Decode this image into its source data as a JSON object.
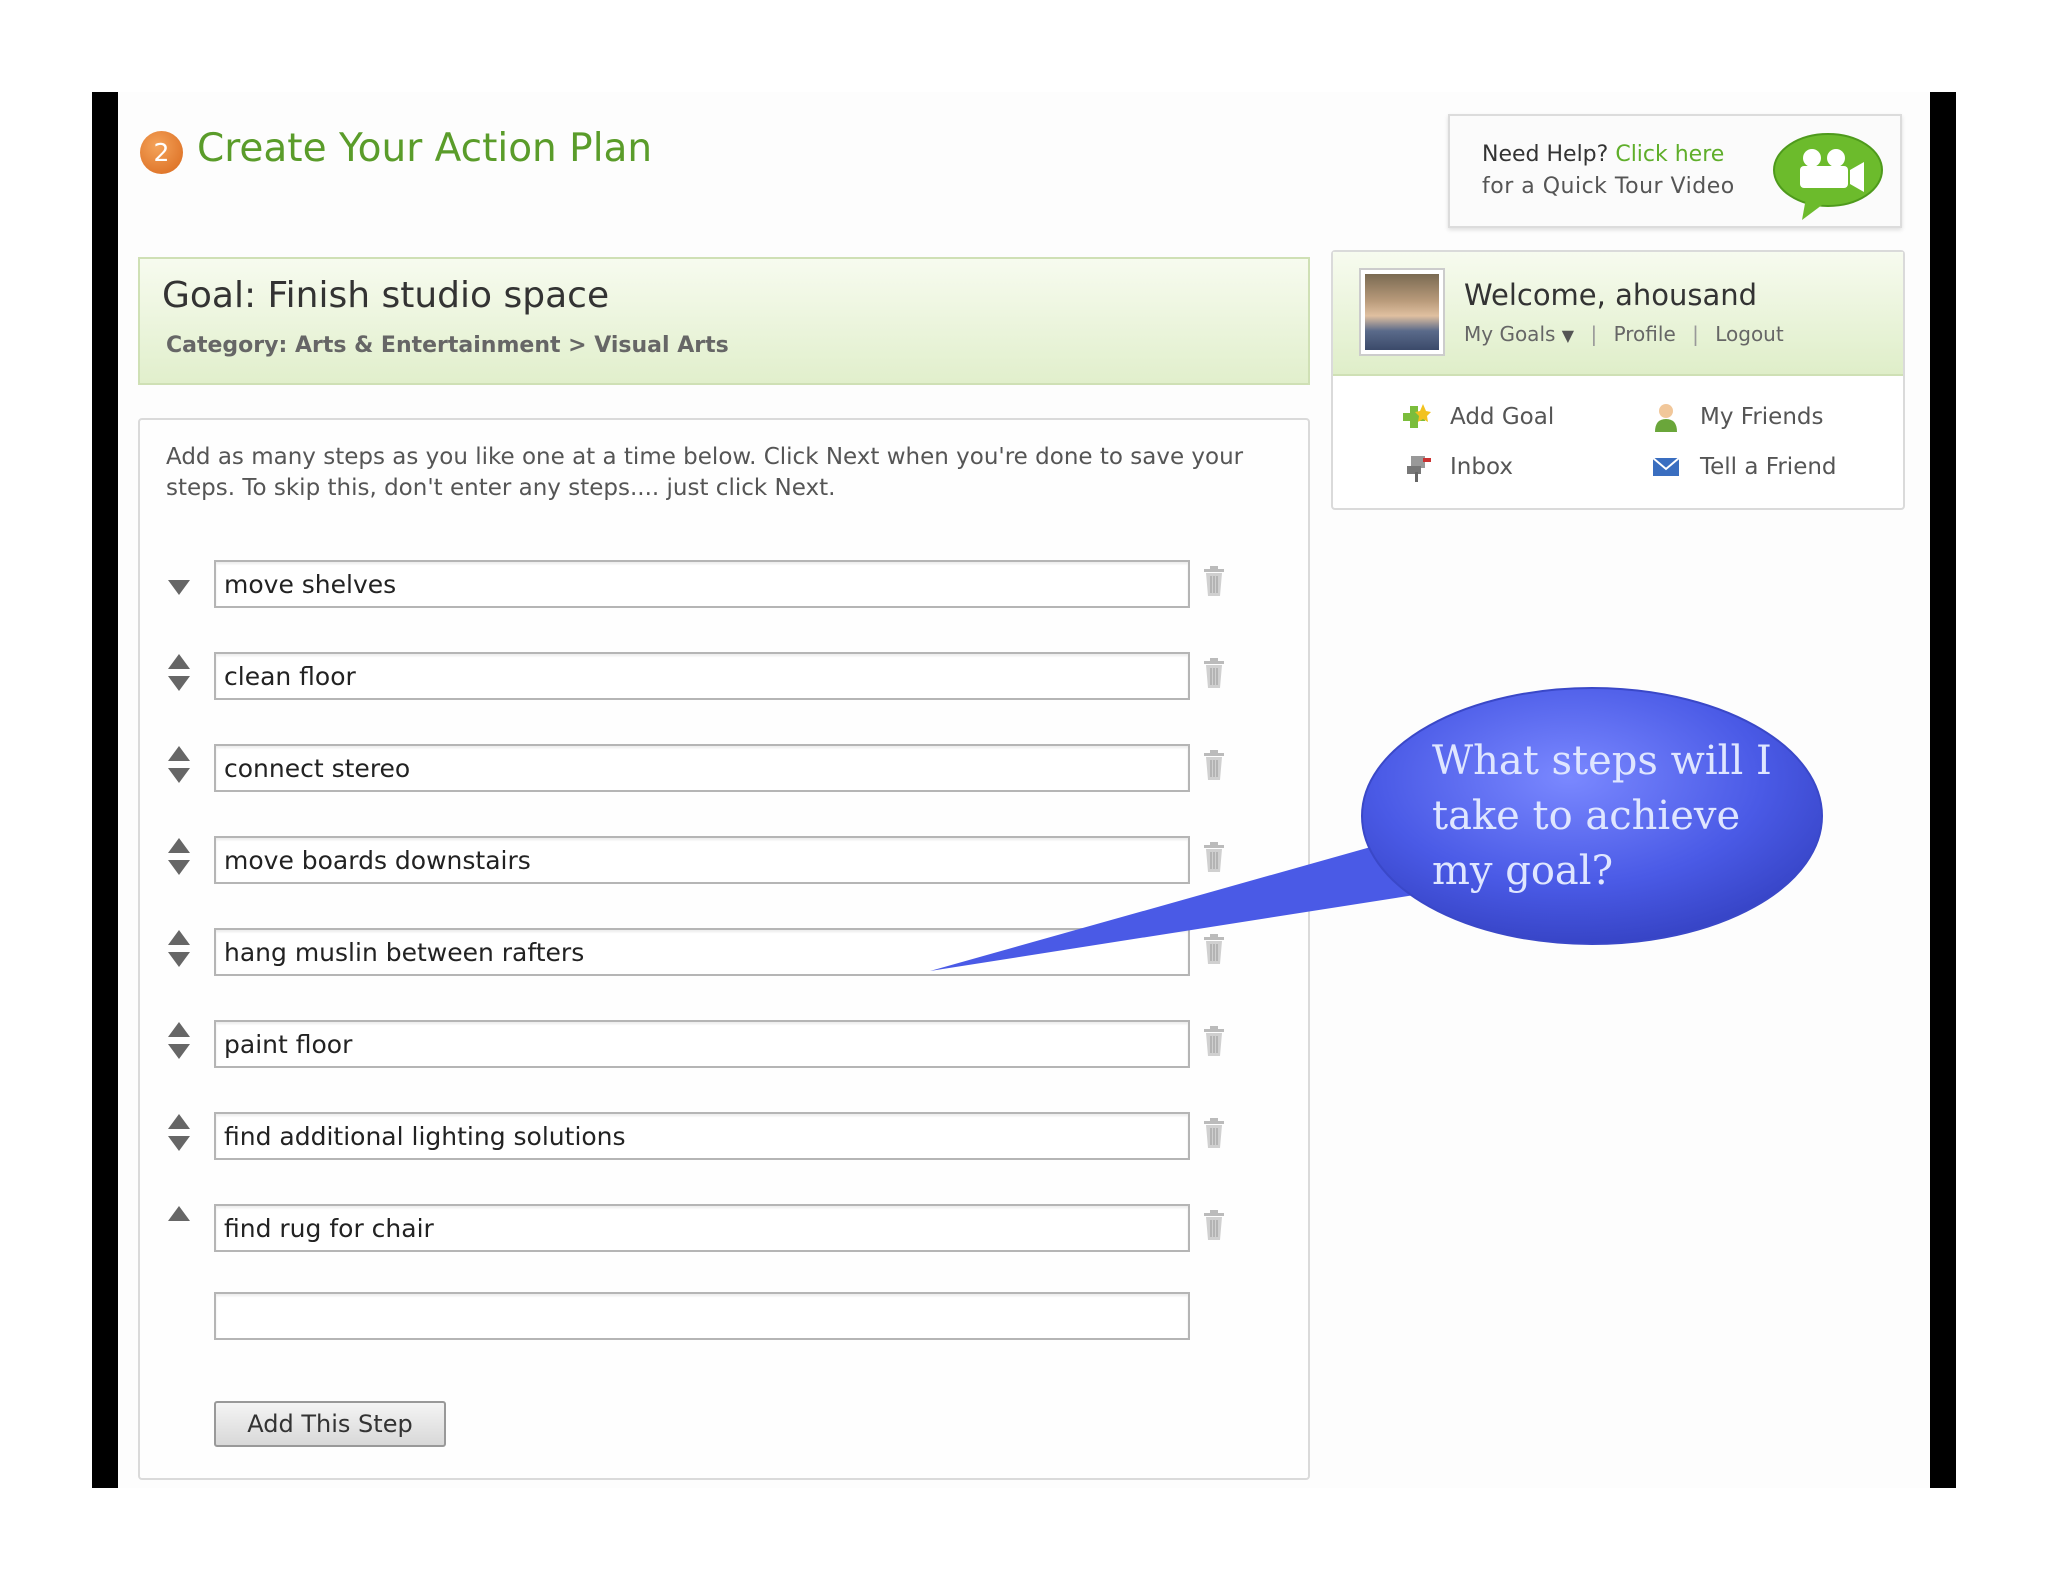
{
  "header": {
    "step_number": "2",
    "title": "Create Your Action Plan"
  },
  "help": {
    "prefix": "Need Help?",
    "link": "Click here",
    "line2": "for a Quick Tour Video"
  },
  "goal": {
    "title": "Goal: Finish studio space",
    "category": "Category: Arts & Entertainment > Visual Arts"
  },
  "user": {
    "welcome": "Welcome, ahousand",
    "links": {
      "my_goals": "My Goals",
      "profile": "Profile",
      "logout": "Logout"
    },
    "menu": {
      "add_goal": "Add Goal",
      "my_friends": "My Friends",
      "inbox": "Inbox",
      "tell_friend": "Tell a Friend"
    }
  },
  "steps_panel": {
    "instructions": "Add as many steps as you like one at a time below. Click Next when you're done to save your steps. To skip this, don't enter any steps.... just click Next.",
    "steps": [
      "move shelves",
      "clean floor",
      "connect stereo",
      "move boards downstairs",
      "hang muslin between rafters",
      "paint floor",
      "find additional lighting solutions",
      "find rug for chair"
    ],
    "new_step_value": "",
    "add_button": "Add This Step"
  },
  "callout": {
    "text": "What steps will I take to achieve my goal?"
  },
  "colors": {
    "brand_green": "#5a9c2a",
    "link_green": "#5fae2a",
    "badge_orange": "#e07a2a",
    "callout_blue": "#4a5ae6"
  }
}
